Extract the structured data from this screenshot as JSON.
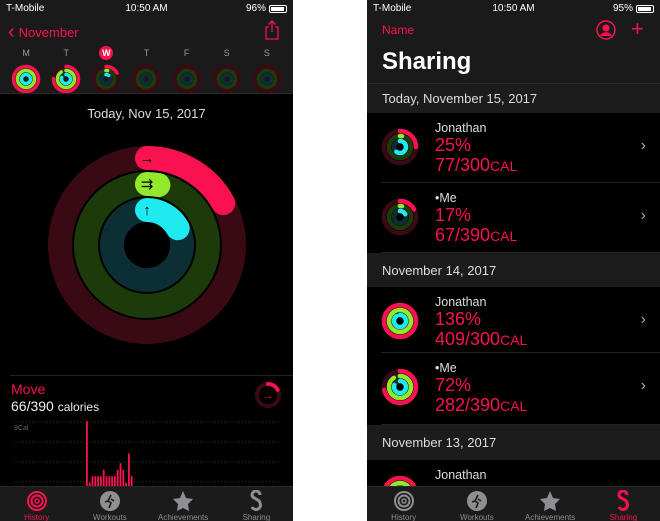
{
  "colors": {
    "move": "#fa114f",
    "exercise": "#92e82a",
    "stand": "#1eeaef",
    "accent": "#fa114f"
  },
  "left": {
    "status": {
      "carrier": "T-Mobile",
      "time": "10:50 AM",
      "battery": "96%",
      "battery_level": 0.96
    },
    "nav": {
      "back_label": "November",
      "share_icon": "share-icon"
    },
    "week": [
      {
        "label": "M",
        "rings": [
          1.3,
          1.0,
          1.0
        ]
      },
      {
        "label": "T",
        "rings": [
          0.75,
          0.9,
          0.8
        ]
      },
      {
        "label": "W",
        "rings": [
          0.17,
          0.03,
          0.1
        ],
        "selected": true
      },
      {
        "label": "T",
        "rings": [
          0,
          0,
          0
        ]
      },
      {
        "label": "F",
        "rings": [
          0,
          0,
          0
        ]
      },
      {
        "label": "S",
        "rings": [
          0,
          0,
          0
        ]
      },
      {
        "label": "S",
        "rings": [
          0,
          0,
          0
        ]
      }
    ],
    "date": "Today, Nov 15, 2017",
    "big_rings": [
      0.17,
      0.03,
      0.17
    ],
    "move": {
      "title": "Move",
      "value": "66/390",
      "unit": "calories",
      "ring": 0.17
    },
    "chart": {
      "scale_label": "9Cal",
      "values": [
        10,
        0.5,
        1.5,
        1.5,
        1.5,
        1.5,
        2.5,
        1.5,
        1.5,
        1.5,
        1.5,
        2.5,
        3.5,
        2.5,
        0.5,
        5,
        1.5
      ]
    },
    "tabs": [
      {
        "label": "History",
        "icon": "history-icon",
        "active": true
      },
      {
        "label": "Workouts",
        "icon": "workouts-icon"
      },
      {
        "label": "Achievements",
        "icon": "achievements-icon"
      },
      {
        "label": "Sharing",
        "icon": "sharing-icon"
      }
    ]
  },
  "right": {
    "status": {
      "carrier": "T-Mobile",
      "time": "10:50 AM",
      "battery": "95%",
      "battery_level": 0.95
    },
    "nav": {
      "left_label": "Name",
      "profile_icon": "profile-icon",
      "add_icon": "plus-icon"
    },
    "title": "Sharing",
    "sections": [
      {
        "date": "Today, November 15, 2017",
        "rows": [
          {
            "name": "Jonathan",
            "percent": "25%",
            "cal": "77/300",
            "unit": "CAL",
            "rings": [
              0.25,
              0.03,
              0.6
            ]
          },
          {
            "name": "•Me",
            "percent": "17%",
            "cal": "67/390",
            "unit": "CAL",
            "rings": [
              0.17,
              0.03,
              0.17
            ]
          }
        ]
      },
      {
        "date": "November 14, 2017",
        "rows": [
          {
            "name": "Jonathan",
            "percent": "136%",
            "cal": "409/300",
            "unit": "CAL",
            "rings": [
              1.36,
              1.0,
              0.9
            ]
          },
          {
            "name": "•Me",
            "percent": "72%",
            "cal": "282/390",
            "unit": "CAL",
            "rings": [
              0.72,
              0.9,
              0.8
            ]
          }
        ]
      },
      {
        "date": "November 13, 2017",
        "rows": [
          {
            "name": "Jonathan",
            "percent": "",
            "cal": "",
            "unit": "",
            "rings": [
              1.3,
              1.0,
              1.0
            ]
          }
        ]
      }
    ],
    "tabs": [
      {
        "label": "History",
        "icon": "history-icon"
      },
      {
        "label": "Workouts",
        "icon": "workouts-icon"
      },
      {
        "label": "Achievements",
        "icon": "achievements-icon"
      },
      {
        "label": "Sharing",
        "icon": "sharing-icon",
        "active": true
      }
    ]
  }
}
